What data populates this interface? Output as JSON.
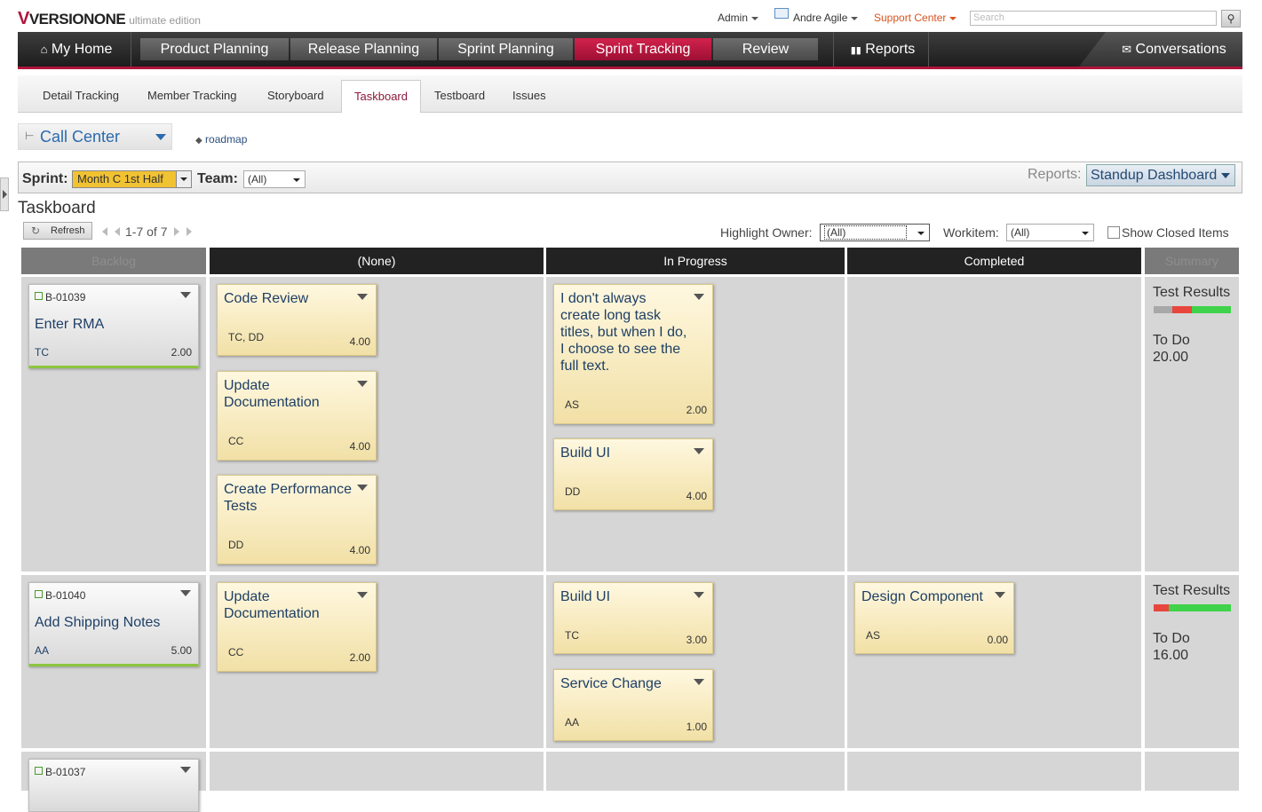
{
  "header": {
    "logo": "VERSIONONE",
    "edition": "ultimate edition",
    "admin": "Admin",
    "user": "Andre Agile",
    "support": "Support Center",
    "search_placeholder": "Search"
  },
  "nav": {
    "my_home": "My Home",
    "tabs": [
      "Product Planning",
      "Release Planning",
      "Sprint Planning",
      "Sprint Tracking",
      "Review"
    ],
    "active_tab": "Sprint Tracking",
    "reports": "Reports",
    "conversations": "Conversations"
  },
  "subnav": {
    "items": [
      "Detail Tracking",
      "Member Tracking",
      "Storyboard",
      "Taskboard",
      "Testboard",
      "Issues"
    ],
    "active": "Taskboard"
  },
  "project": {
    "name": "Call Center",
    "roadmap": "roadmap"
  },
  "filters": {
    "sprint_label": "Sprint:",
    "sprint_value": "Month C 1st Half",
    "team_label": "Team:",
    "team_value": "(All)",
    "reports_label": "Reports:",
    "reports_value": "Standup Dashboard"
  },
  "board": {
    "title": "Taskboard",
    "refresh": "Refresh",
    "paging": "1-7 of 7",
    "highlight_label": "Highlight Owner:",
    "highlight_value": "(All)",
    "workitem_label": "Workitem:",
    "workitem_value": "(All)",
    "show_closed": "Show Closed Items",
    "columns": [
      "Backlog",
      "(None)",
      "In Progress",
      "Completed",
      "Summary"
    ]
  },
  "rows": [
    {
      "story": {
        "id": "B-01039",
        "title": "Enter RMA",
        "owner": "TC",
        "estimate": "2.00"
      },
      "none": [
        {
          "title": "Code Review",
          "owner": "TC, DD",
          "estimate": "4.00"
        },
        {
          "title": "Update Documentation",
          "owner": "CC",
          "estimate": "4.00"
        },
        {
          "title": "Create Performance Tests",
          "owner": "DD",
          "estimate": "4.00"
        }
      ],
      "in_progress": [
        {
          "title": "I don't always create long task titles, but when I do, I choose to see the full text.",
          "owner": "AS",
          "estimate": "2.00"
        },
        {
          "title": "Build UI",
          "owner": "DD",
          "estimate": "4.00"
        }
      ],
      "completed": [],
      "summary": {
        "test_label": "Test Results",
        "todo_label": "To Do",
        "todo": "20.00"
      }
    },
    {
      "story": {
        "id": "B-01040",
        "title": "Add Shipping Notes",
        "owner": "AA",
        "estimate": "5.00"
      },
      "none": [
        {
          "title": "Update Documentation",
          "owner": "CC",
          "estimate": "2.00"
        }
      ],
      "in_progress": [
        {
          "title": "Build UI",
          "owner": "TC",
          "estimate": "3.00"
        },
        {
          "title": "Service Change",
          "owner": "AA",
          "estimate": "1.00"
        }
      ],
      "completed": [
        {
          "title": "Design Component",
          "owner": "AS",
          "estimate": "0.00"
        }
      ],
      "summary": {
        "test_label": "Test Results",
        "todo_label": "To Do",
        "todo": "16.00"
      }
    },
    {
      "story": {
        "id": "B-01037"
      }
    }
  ],
  "colors": {
    "accent": "#b0143c",
    "card": "#f6e9b8",
    "story_border": "#8dc63f",
    "link": "#2b6aad"
  }
}
